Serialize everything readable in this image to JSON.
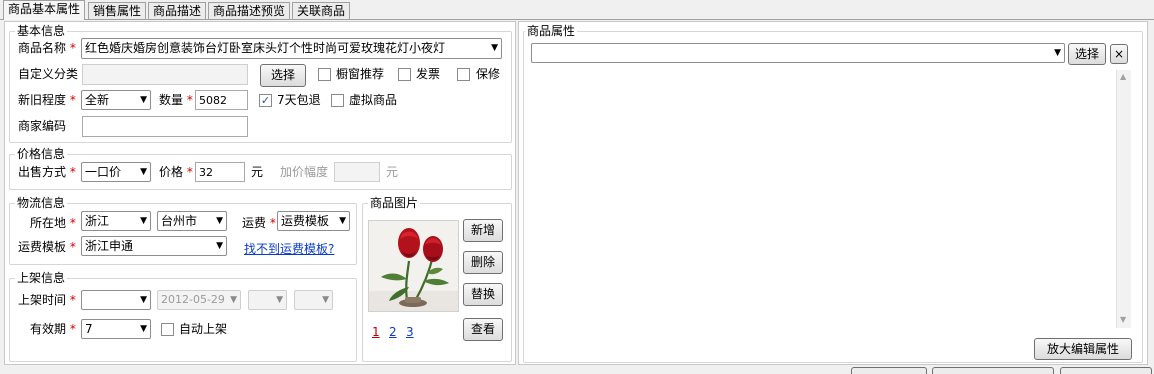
{
  "tabs": [
    "商品基本属性",
    "销售属性",
    "商品描述",
    "商品描述预览",
    "关联商品"
  ],
  "basic": {
    "title": "基本信息",
    "name_label": "商品名称",
    "name_value": "红色婚庆婚房创意装饰台灯卧室床头灯个性时尚可爱玫瑰花灯小夜灯",
    "category_label": "自定义分类",
    "category_value": "",
    "select_button": "选择",
    "window_recommend": "橱窗推荐",
    "invoice": "发票",
    "warranty": "保修",
    "condition_label": "新旧程度",
    "condition_value": "全新",
    "quantity_label": "数量",
    "quantity_value": "5082",
    "return7": "7天包退",
    "virtual": "虚拟商品",
    "merchant_code_label": "商家编码",
    "merchant_code_value": ""
  },
  "price": {
    "title": "价格信息",
    "method_label": "出售方式",
    "method_value": "一口价",
    "price_label": "价格",
    "price_value": "32",
    "unit": "元",
    "markup_label": "加价幅度",
    "markup_value": "",
    "markup_unit": "元"
  },
  "logistics": {
    "title": "物流信息",
    "location_label": "所在地",
    "province": "浙江",
    "city": "台州市",
    "freight_label": "运费",
    "freight_value": "运费模板",
    "template_label": "运费模板",
    "template_value": "浙江申通",
    "missing_link": "找不到运费模板?"
  },
  "listing": {
    "title": "上架信息",
    "time_label": "上架时间",
    "date_value": "2012-05-29",
    "validity_label": "有效期",
    "validity_value": "7",
    "auto_list": "自动上架"
  },
  "images": {
    "title": "商品图片",
    "add": "新增",
    "delete": "删除",
    "replace": "替换",
    "view": "查看",
    "pages": [
      "1",
      "2",
      "3"
    ]
  },
  "props": {
    "title": "商品属性",
    "select_button": "选择",
    "close": "×",
    "expand_button": "放大编辑属性"
  },
  "icons": {
    "check": "✓",
    "dropdown": "▼",
    "scroll_up": "▲",
    "scroll_down": "▼"
  }
}
